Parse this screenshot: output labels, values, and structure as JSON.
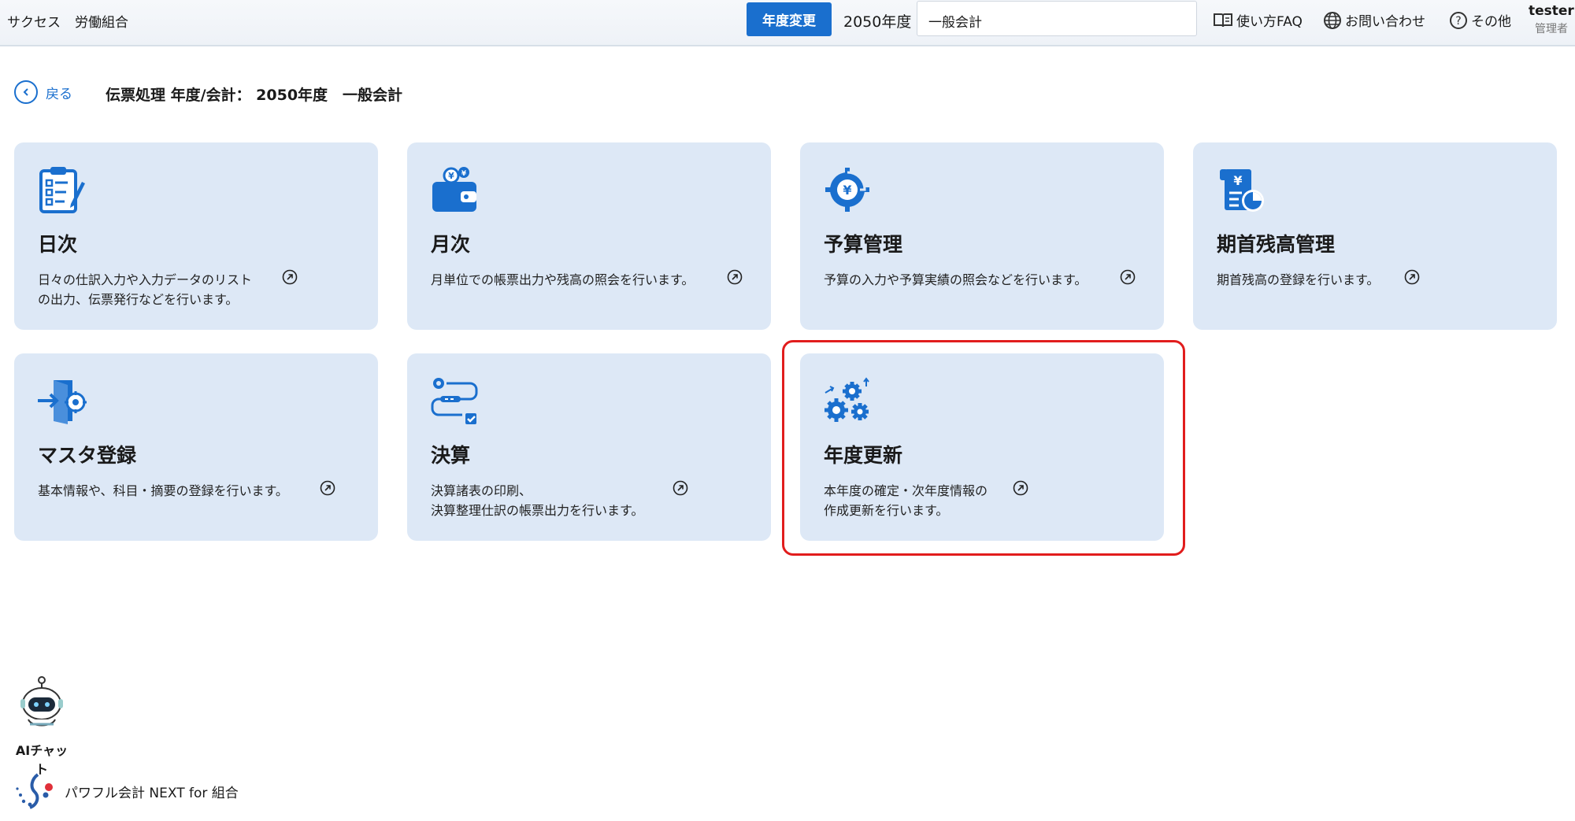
{
  "header": {
    "org_name": "サクセス",
    "org_type": "労働組合",
    "year_change_button": "年度変更",
    "fiscal_year": "2050年度",
    "account_select_value": "一般会計",
    "faq_link": "使い方FAQ",
    "contact_link": "お問い合わせ",
    "other_link": "その他",
    "user_name": "tester",
    "user_role": "管理者"
  },
  "breadcrumb": {
    "back_label": "戻る",
    "title": "伝票処理 年度/会計： 2050年度　一般会計"
  },
  "cards": [
    {
      "title": "日次",
      "desc_line1": "日々の仕訳入力や入力データのリスト",
      "desc_line2": "の出力、伝票発行などを行います。",
      "icon": "clipboard-checklist-icon"
    },
    {
      "title": "月次",
      "desc_line1": "月単位での帳票出力や残高の照会を行います。",
      "desc_line2": "",
      "icon": "wallet-yen-icon"
    },
    {
      "title": "予算管理",
      "desc_line1": "予算の入力や予算実績の照会などを行います。",
      "desc_line2": "",
      "icon": "yen-gear-icon"
    },
    {
      "title": "期首残高管理",
      "desc_line1": "期首残高の登録を行います。",
      "desc_line2": "",
      "icon": "yen-document-chart-icon"
    },
    {
      "title": "マスタ登録",
      "desc_line1": "基本情報や、科目・摘要の登録を行います。",
      "desc_line2": "",
      "icon": "door-gear-icon"
    },
    {
      "title": "決算",
      "desc_line1": "決算諸表の印刷、",
      "desc_line2": "決算整理仕訳の帳票出力を行います。",
      "icon": "gear-flow-check-icon"
    },
    {
      "title": "年度更新",
      "desc_line1": "本年度の確定・次年度情報の",
      "desc_line2": "作成更新を行います。",
      "icon": "gears-refresh-icon"
    }
  ],
  "ai_chat_label": "AIチャット",
  "brand_name": "パワフル会計 NEXT for 組合",
  "colors": {
    "accent": "#1a6fce",
    "card_bg": "#dde8f6",
    "highlight": "#e11d1d"
  }
}
